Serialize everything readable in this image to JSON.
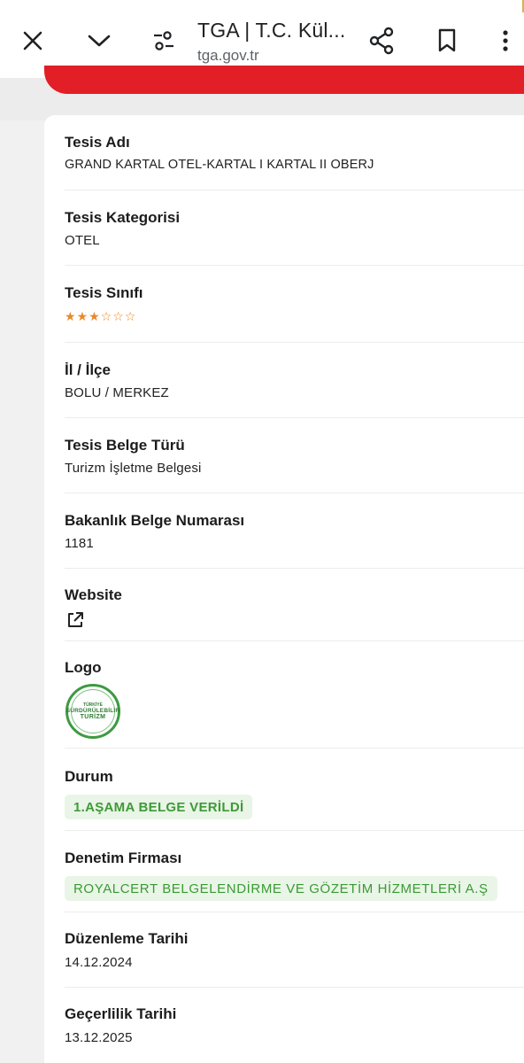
{
  "browser": {
    "title": "TGA | T.C. Kül...",
    "url": "tga.gov.tr",
    "icons": [
      "close-icon",
      "chevron-down-icon",
      "page-settings-icon",
      "share-icon",
      "bookmark-icon",
      "more-vert-icon"
    ]
  },
  "colors": {
    "accent_red": "#e21e26",
    "star": "#e8892b",
    "badge_bg": "#e9f5e6",
    "badge_text": "#3f9a38"
  },
  "fields": {
    "tesis_adi": {
      "label": "Tesis Adı",
      "value": "GRAND KARTAL OTEL-KARTAL I KARTAL II OBERJ"
    },
    "tesis_kategorisi": {
      "label": "Tesis Kategorisi",
      "value": "OTEL"
    },
    "tesis_sinifi": {
      "label": "Tesis Sınıfı",
      "stars_filled": 3,
      "stars_total": 6
    },
    "il_ilce": {
      "label": "İl / İlçe",
      "value": "BOLU / MERKEZ"
    },
    "belge_turu": {
      "label": "Tesis Belge Türü",
      "value": "Turizm İşletme Belgesi"
    },
    "belge_no": {
      "label": "Bakanlık Belge Numarası",
      "value": "1181"
    },
    "website": {
      "label": "Website",
      "icon": "external-link-icon"
    },
    "logo": {
      "label": "Logo",
      "logo_line1": "TÜRKİYE",
      "logo_line2": "SÜRDÜRÜLEBİLİR",
      "logo_line3": "TURİZM"
    },
    "durum": {
      "label": "Durum",
      "value": "1.AŞAMA BELGE VERİLDİ"
    },
    "denetim": {
      "label": "Denetim Firması",
      "value": "ROYALCERT BELGELENDİRME VE GÖZETİM HİZMETLERİ A.Ş"
    },
    "duzenleme": {
      "label": "Düzenleme Tarihi",
      "value": "14.12.2024"
    },
    "gecerlilik": {
      "label": "Geçerlilik Tarihi",
      "value": "13.12.2025"
    }
  }
}
